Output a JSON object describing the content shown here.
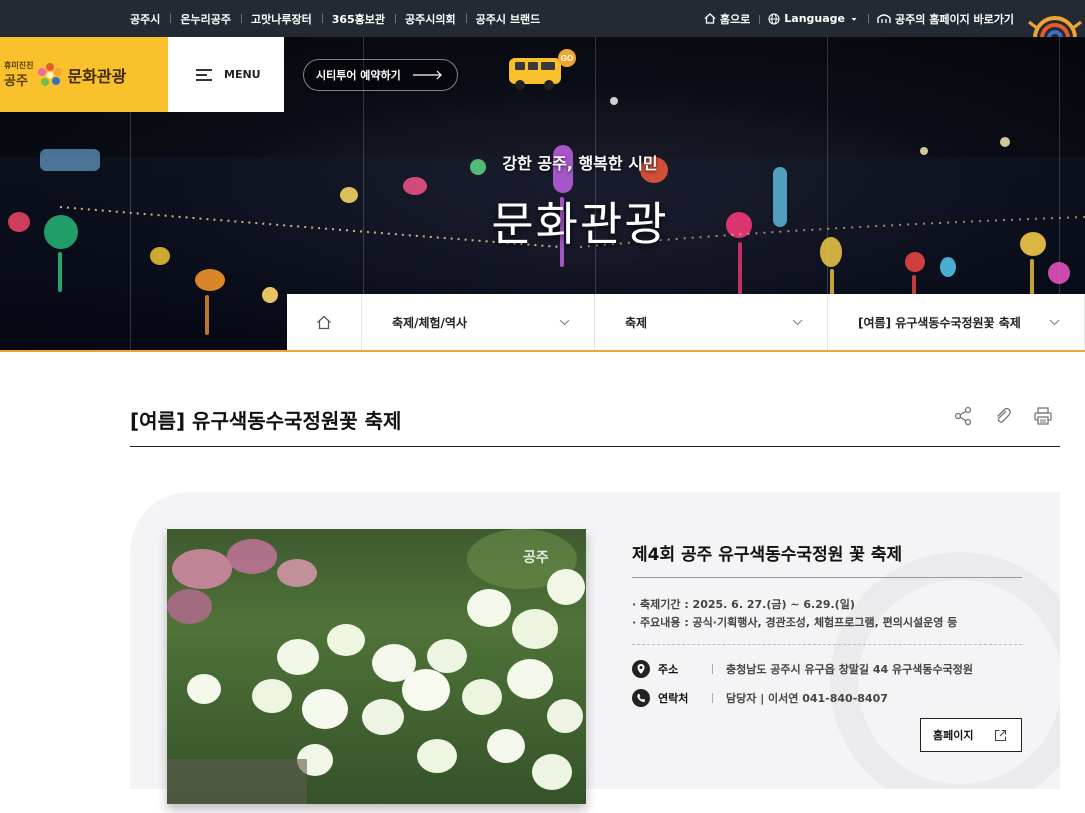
{
  "topbar": {
    "links": [
      "공주시",
      "온누리공주",
      "고맛나루장터",
      "365홍보관",
      "공주시의회",
      "공주시 브랜드"
    ],
    "home": "홈으로",
    "language": "Language",
    "homepage": "공주의 홈페이지 바로가기"
  },
  "logo": {
    "slogan": "휴미진진",
    "city": "공주",
    "title": "문화관광"
  },
  "menu": {
    "label": "MENU"
  },
  "tour": {
    "label": "시티투어 예약하기",
    "bus_badge": "GO"
  },
  "hero": {
    "subtitle": "강한 공주, 행복한 시민",
    "title": "문화관광"
  },
  "breadcrumb": {
    "items": [
      "축제/체험/역사",
      "축제",
      "[여름] 유구색동수국정원꽃 축제"
    ]
  },
  "page": {
    "title": "[여름] 유구색동수국정원꽃 축제"
  },
  "festival": {
    "photo_watermark": "공주",
    "title": "제4회 공주 유구색동수국정원 꽃 축제",
    "period": "· 축제기간 : 2025. 6. 27.(금) ~ 6.29.(일)",
    "content": "· 주요내용 : 공식·기획행사, 경관조성, 체험프로그램, 편의시설운영 등",
    "address_label": "주소",
    "address": "충청남도 공주시 유구읍 창말길 44 유구색동수국정원",
    "contact_label": "연락처",
    "contact": "담당자 | 이서연 041-840-8407",
    "homepage_button": "홈페이지"
  },
  "colors": {
    "accent": "#f9c12b",
    "topbar": "#242a33",
    "orange_line": "#f0a431"
  }
}
